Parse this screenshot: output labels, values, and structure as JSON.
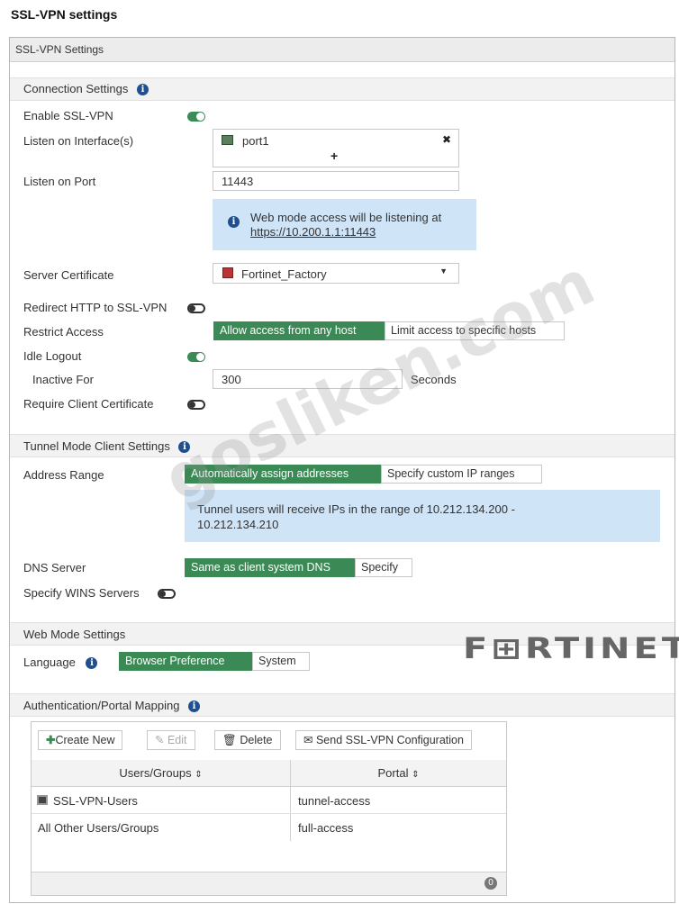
{
  "page_title": "SSL-VPN settings",
  "panel_title": "SSL-VPN Settings",
  "connection": {
    "section_title": "Connection Settings",
    "enable_label": "Enable SSL-VPN",
    "enable_on": true,
    "listen_interface_label": "Listen on Interface(s)",
    "interface_value": "port1",
    "add_glyph": "+",
    "remove_glyph": "✖",
    "listen_port_label": "Listen on Port",
    "listen_port_value": "11443",
    "web_mode_info": "Web mode access will be listening at",
    "web_mode_url": "https://10.200.1.1:11443",
    "server_cert_label": "Server Certificate",
    "server_cert_value": "Fortinet_Factory",
    "redirect_label": "Redirect HTTP to SSL-VPN",
    "redirect_on": false,
    "restrict_label": "Restrict Access",
    "restrict_options": [
      "Allow access from any host",
      "Limit access to specific hosts"
    ],
    "restrict_selected": 0,
    "idle_logout_label": "Idle Logout",
    "idle_logout_on": true,
    "inactive_label": "Inactive For",
    "inactive_value": "300",
    "inactive_unit": "Seconds",
    "client_cert_label": "Require Client Certificate",
    "client_cert_on": false
  },
  "tunnel": {
    "section_title": "Tunnel Mode Client Settings",
    "address_range_label": "Address Range",
    "address_options": [
      "Automatically assign addresses",
      "Specify custom IP ranges"
    ],
    "address_selected": 0,
    "range_info_line1": "Tunnel users will receive IPs in the range of 10.212.134.200 -",
    "range_info_line2": "10.212.134.210",
    "dns_label": "DNS Server",
    "dns_options": [
      "Same as client system DNS",
      "Specify"
    ],
    "dns_selected": 0,
    "wins_label": "Specify WINS Servers",
    "wins_on": false
  },
  "web_mode": {
    "section_title": "Web Mode Settings",
    "language_label": "Language",
    "language_options": [
      "Browser Preference",
      "System"
    ],
    "language_selected": 0
  },
  "auth": {
    "section_title": "Authentication/Portal Mapping",
    "create_new": "Create New",
    "edit": "Edit",
    "delete": "Delete",
    "send_config": "Send SSL-VPN Configuration",
    "col_users": "Users/Groups",
    "col_portal": "Portal",
    "sort_glyph": "⇕",
    "rows": [
      {
        "users": "SSL-VPN-Users",
        "portal": "tunnel-access"
      },
      {
        "users": "All Other Users/Groups",
        "portal": "full-access"
      }
    ],
    "footer_count": "0"
  },
  "brand": "F⊞RTINET",
  "watermark": "gosliken.com",
  "colors": {
    "accent_green": "#3b8a55",
    "info_blue": "#cfe4f7",
    "icon_blue": "#1f4f8f"
  }
}
